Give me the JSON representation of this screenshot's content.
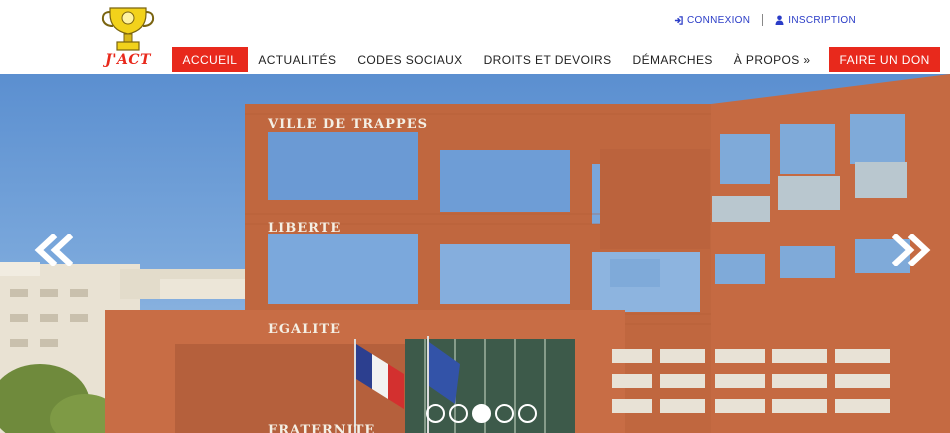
{
  "brand": {
    "logo_text": "J'ACT"
  },
  "account": {
    "login": "CONNEXION",
    "register": "INSCRIPTION"
  },
  "nav": {
    "items": [
      "ACCUEIL",
      "ACTUALITÉS",
      "CODES SOCIAUX",
      "DROITS ET DEVOIRS",
      "DÉMARCHES",
      "À PROPOS »"
    ],
    "donate": "FAIRE UN DON"
  },
  "slider": {
    "building_signs": [
      "VILLE DE TRAPPES",
      "LIBERTE",
      "EGALITE",
      "FRATERNITE"
    ],
    "slide_count": 5,
    "active_slide": 3
  },
  "colors": {
    "accent": "#e8291c",
    "link": "#2a3cc7"
  }
}
